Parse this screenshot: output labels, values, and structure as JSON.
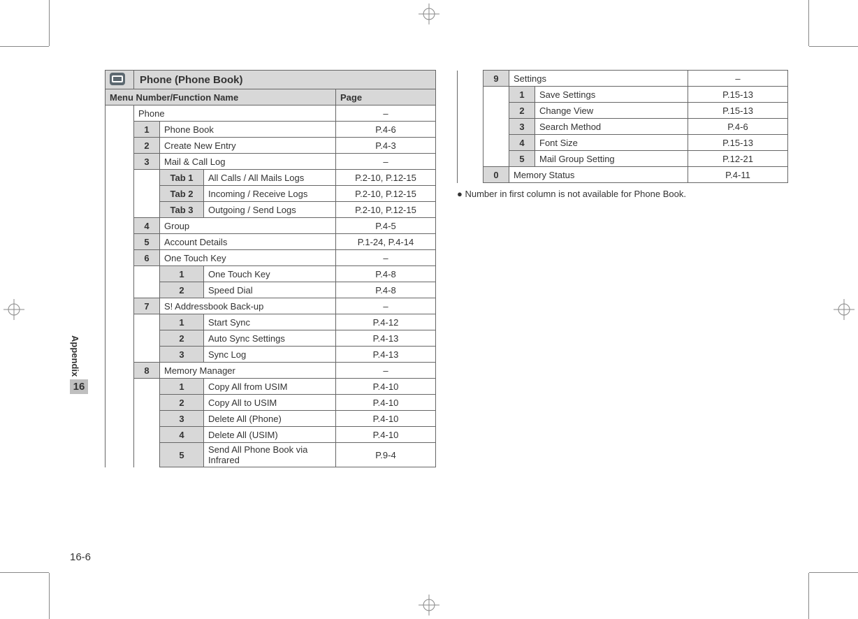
{
  "section_title": "Phone (Phone Book)",
  "header": {
    "menu": "Menu Number/Function Name",
    "page": "Page"
  },
  "left_rows": [
    {
      "type": "top",
      "label": "Phone",
      "page": "–"
    },
    {
      "type": "num",
      "n": "1",
      "label": "Phone Book",
      "page": "P.4-6"
    },
    {
      "type": "num",
      "n": "2",
      "label": "Create New Entry",
      "page": "P.4-3"
    },
    {
      "type": "num",
      "n": "3",
      "label": "Mail & Call Log",
      "page": "–"
    },
    {
      "type": "tab",
      "n": "Tab 1",
      "label": "All Calls / All Mails Logs",
      "page": "P.2-10, P.12-15"
    },
    {
      "type": "tab",
      "n": "Tab 2",
      "label": "Incoming / Receive Logs",
      "page": "P.2-10, P.12-15"
    },
    {
      "type": "tab",
      "n": "Tab 3",
      "label": "Outgoing / Send Logs",
      "page": "P.2-10, P.12-15"
    },
    {
      "type": "num",
      "n": "4",
      "label": "Group",
      "page": "P.4-5"
    },
    {
      "type": "num",
      "n": "5",
      "label": "Account Details",
      "page": "P.1-24, P.4-14"
    },
    {
      "type": "num",
      "n": "6",
      "label": "One Touch Key",
      "page": "–"
    },
    {
      "type": "sub",
      "n": "1",
      "label": "One Touch Key",
      "page": "P.4-8"
    },
    {
      "type": "sub",
      "n": "2",
      "label": "Speed Dial",
      "page": "P.4-8"
    },
    {
      "type": "num",
      "n": "7",
      "label": "S! Addressbook Back-up",
      "page": "–"
    },
    {
      "type": "sub",
      "n": "1",
      "label": "Start Sync",
      "page": "P.4-12"
    },
    {
      "type": "sub",
      "n": "2",
      "label": "Auto Sync Settings",
      "page": "P.4-13"
    },
    {
      "type": "sub",
      "n": "3",
      "label": "Sync Log",
      "page": "P.4-13"
    },
    {
      "type": "num",
      "n": "8",
      "label": "Memory Manager",
      "page": "–"
    },
    {
      "type": "sub",
      "n": "1",
      "label": "Copy All from USIM",
      "page": "P.4-10"
    },
    {
      "type": "sub",
      "n": "2",
      "label": "Copy All to USIM",
      "page": "P.4-10"
    },
    {
      "type": "sub",
      "n": "3",
      "label": "Delete All (Phone)",
      "page": "P.4-10"
    },
    {
      "type": "sub",
      "n": "4",
      "label": "Delete All (USIM)",
      "page": "P.4-10"
    },
    {
      "type": "sub",
      "n": "5",
      "label": "Send All Phone Book via Infrared",
      "page": "P.9-4"
    }
  ],
  "right_rows": [
    {
      "type": "num",
      "n": "9",
      "label": "Settings",
      "page": "–"
    },
    {
      "type": "sub",
      "n": "1",
      "label": "Save Settings",
      "page": "P.15-13"
    },
    {
      "type": "sub",
      "n": "2",
      "label": "Change View",
      "page": "P.15-13"
    },
    {
      "type": "sub",
      "n": "3",
      "label": "Search Method",
      "page": "P.4-6"
    },
    {
      "type": "sub",
      "n": "4",
      "label": "Font Size",
      "page": "P.15-13"
    },
    {
      "type": "sub",
      "n": "5",
      "label": "Mail Group Setting",
      "page": "P.12-21"
    },
    {
      "type": "num",
      "n": "0",
      "label": "Memory Status",
      "page": "P.4-11"
    }
  ],
  "note": "Number in first column is not available for Phone Book.",
  "sidebar": {
    "label": "Appendix",
    "chapter": "16"
  },
  "page_number": "16-6"
}
